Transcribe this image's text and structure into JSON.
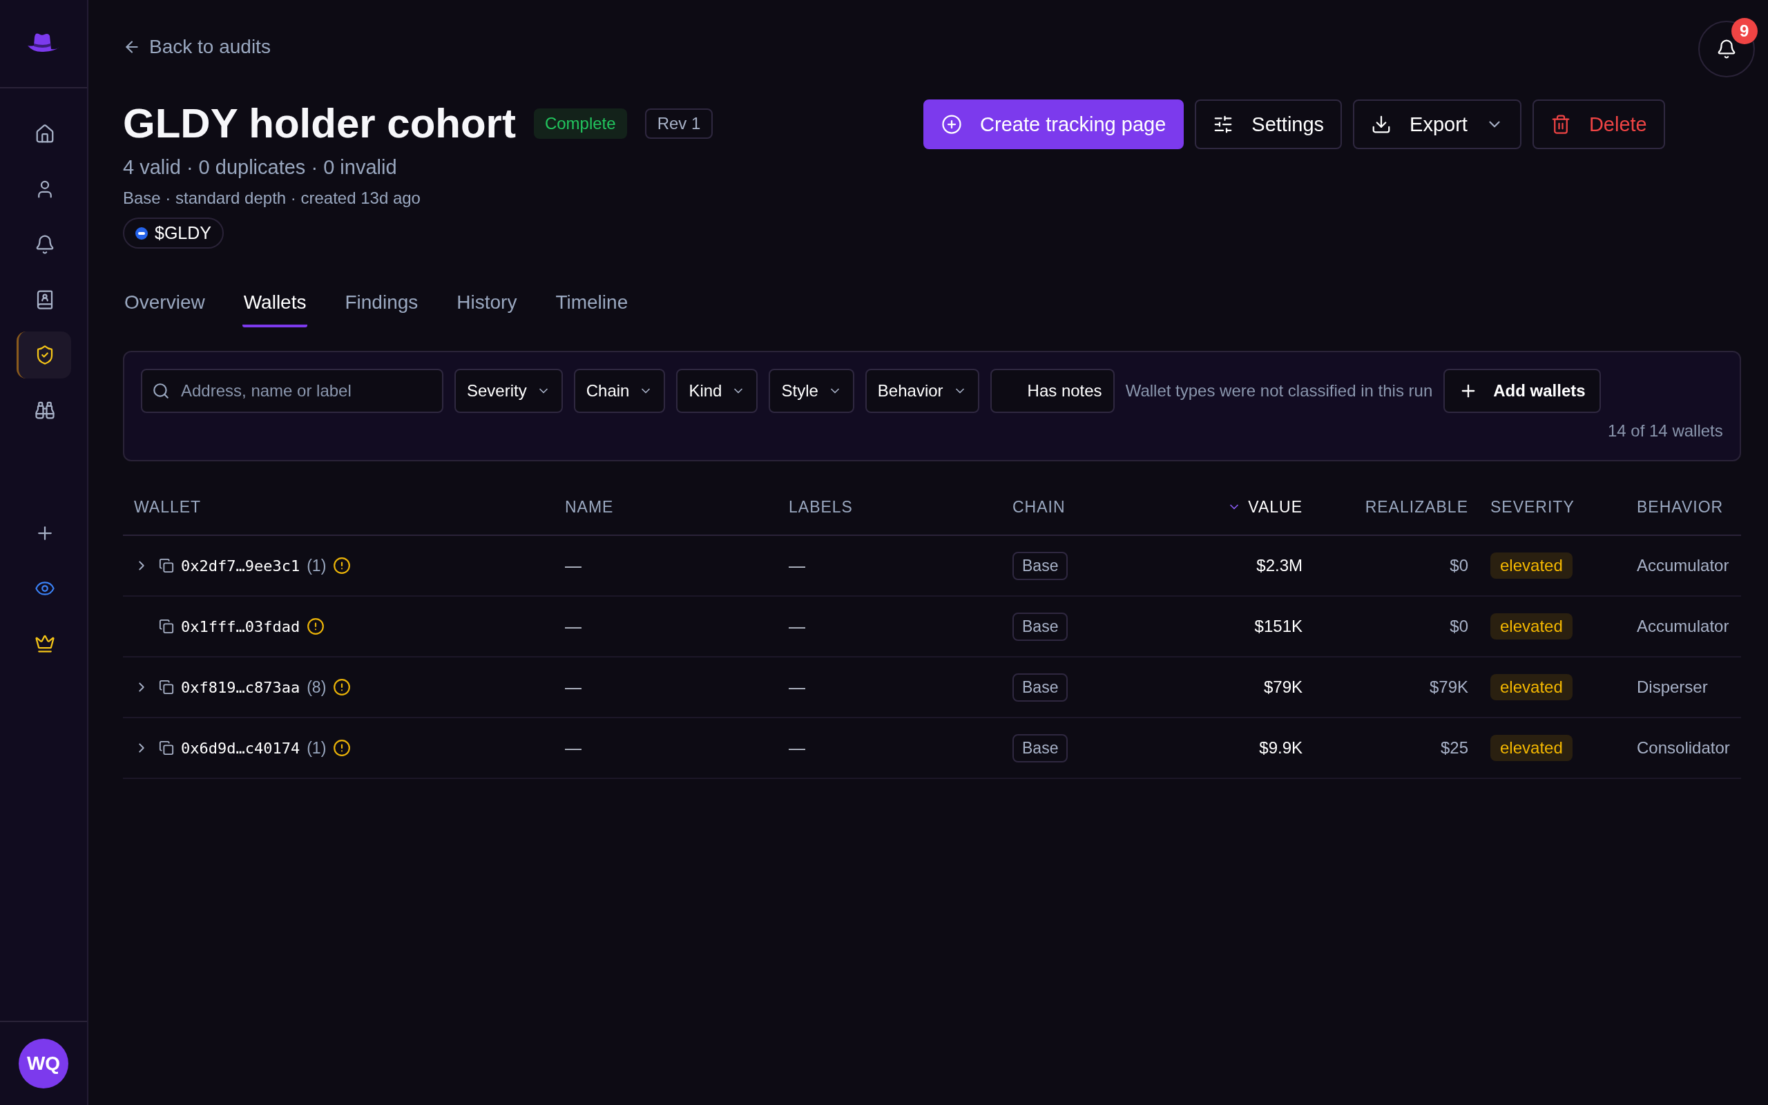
{
  "sidebar": {
    "items": [
      {
        "selected": false
      },
      {
        "selected": false
      },
      {
        "selected": false
      },
      {
        "selected": false
      },
      {
        "selected": true
      },
      {
        "selected": false
      }
    ],
    "avatar": "WQ"
  },
  "notifications": {
    "count": "9"
  },
  "back_link": "Back to audits",
  "title": "GLDY holder cohort",
  "status_badge": "Complete",
  "revision": "Rev 1",
  "summary": "4 valid · 0 duplicates · 0 invalid",
  "meta": "Base · standard depth · created 13d ago",
  "token": "$GLDY",
  "actions": [
    {
      "kind": "primary",
      "label": "Create tracking page"
    },
    {
      "kind": "plain",
      "label": "Settings"
    },
    {
      "kind": "dropdown",
      "label": "Export"
    },
    {
      "kind": "danger",
      "label": "Delete"
    }
  ],
  "tabs": [
    {
      "label": "Overview",
      "selected": false
    },
    {
      "label": "Wallets",
      "selected": true
    },
    {
      "label": "Findings",
      "selected": false
    },
    {
      "label": "History",
      "selected": false
    },
    {
      "label": "Timeline",
      "selected": false
    }
  ],
  "filters": {
    "search": {
      "placeholder": "Address, name or label"
    },
    "dropdowns": [
      "Severity",
      "Chain",
      "Kind",
      "Style",
      "Behavior"
    ],
    "toggle": "Has notes",
    "note": "Wallet types were not classified in this run",
    "add_button": "Add wallets",
    "count": "14 of 14 wallets"
  },
  "table": {
    "columns": [
      {
        "label": "WALLET",
        "sorted": false
      },
      {
        "label": "NAME",
        "sorted": false
      },
      {
        "label": "LABELS",
        "sorted": false
      },
      {
        "label": "CHAIN",
        "sorted": false
      },
      {
        "label": "VALUE",
        "sorted": true
      },
      {
        "label": "REALIZABLE",
        "sorted": false
      },
      {
        "label": "SEVERITY",
        "sorted": false
      },
      {
        "label": "BEHAVIOR",
        "sorted": false
      }
    ],
    "rows": [
      {
        "expandable": true,
        "address": "0x2df7…9ee3c1",
        "count": "(1)",
        "name": "—",
        "labels": "—",
        "chain": "Base",
        "value": "$2.3M",
        "realizable": "$0",
        "severity": "elevated",
        "behavior": "Accumulator"
      },
      {
        "expandable": false,
        "address": "0x1fff…03fdad",
        "name": "—",
        "labels": "—",
        "chain": "Base",
        "value": "$151K",
        "realizable": "$0",
        "severity": "elevated",
        "behavior": "Accumulator"
      },
      {
        "expandable": true,
        "address": "0xf819…c873aa",
        "count": "(8)",
        "name": "—",
        "labels": "—",
        "chain": "Base",
        "value": "$79K",
        "realizable": "$79K",
        "severity": "elevated",
        "behavior": "Disperser"
      },
      {
        "expandable": true,
        "address": "0x6d9d…c40174",
        "count": "(1)",
        "name": "—",
        "labels": "—",
        "chain": "Base",
        "value": "$9.9K",
        "realizable": "$25",
        "severity": "elevated",
        "behavior": "Consolidator"
      }
    ]
  }
}
